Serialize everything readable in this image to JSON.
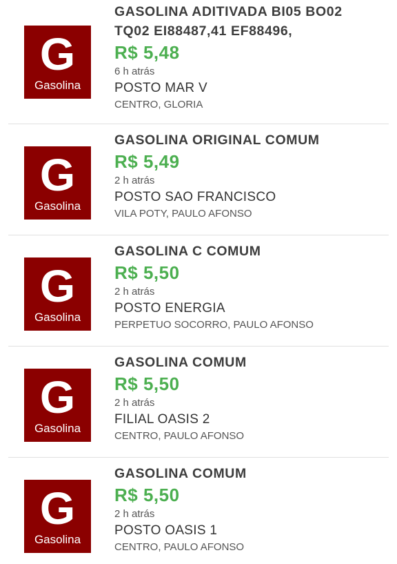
{
  "listings": [
    {
      "icon": {
        "letter": "G",
        "label": "Gasolina"
      },
      "fuel_line1": "GASOLINA ADITIVADA BI05 BO02",
      "fuel_line2": "TQ02 EI88487,41 EF88496,",
      "price": "R$ 5,48",
      "time": "6 h atrás",
      "station": "POSTO MAR V",
      "address": "CENTRO, GLORIA"
    },
    {
      "icon": {
        "letter": "G",
        "label": "Gasolina"
      },
      "fuel": "GASOLINA ORIGINAL COMUM",
      "price": "R$ 5,49",
      "time": "2 h atrás",
      "station": "POSTO SAO FRANCISCO",
      "address": "VILA POTY, PAULO AFONSO"
    },
    {
      "icon": {
        "letter": "G",
        "label": "Gasolina"
      },
      "fuel": "GASOLINA C COMUM",
      "price": "R$ 5,50",
      "time": "2 h atrás",
      "station": "POSTO ENERGIA",
      "address": "PERPETUO SOCORRO, PAULO AFONSO"
    },
    {
      "icon": {
        "letter": "G",
        "label": "Gasolina"
      },
      "fuel": "GASOLINA COMUM",
      "price": "R$ 5,50",
      "time": "2 h atrás",
      "station": "FILIAL OASIS 2",
      "address": "CENTRO, PAULO AFONSO"
    },
    {
      "icon": {
        "letter": "G",
        "label": "Gasolina"
      },
      "fuel": "GASOLINA COMUM",
      "price": "R$ 5,50",
      "time": "2 h atrás",
      "station": "POSTO OASIS 1",
      "address": "CENTRO, PAULO AFONSO"
    }
  ],
  "colors": {
    "icon_background": "#8b0000",
    "price": "#4caf50",
    "fuel_text": "#3d3d3d"
  }
}
